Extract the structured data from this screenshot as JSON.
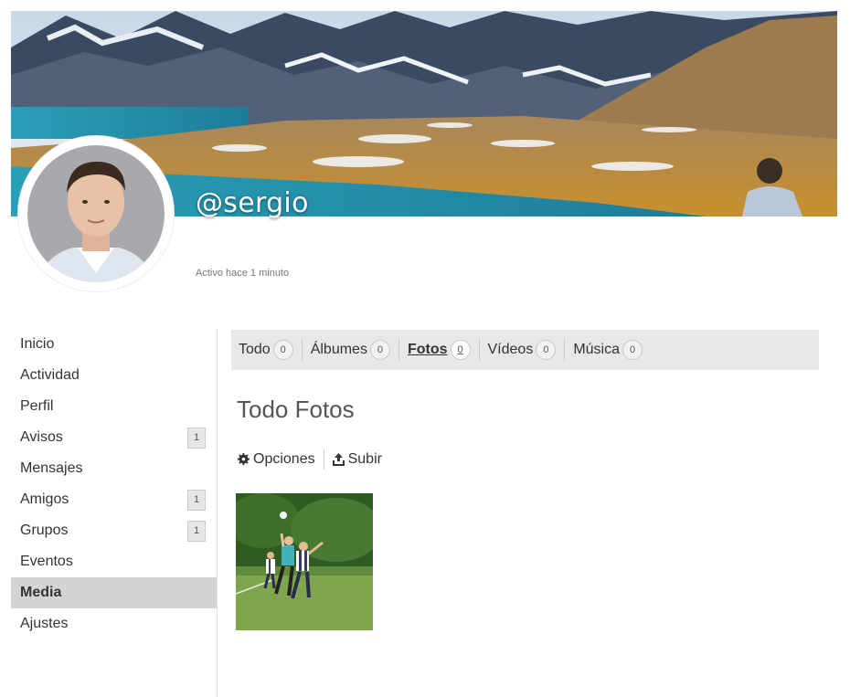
{
  "profile": {
    "username": "@sergio",
    "activity": "Activo hace 1 minuto"
  },
  "sidebar": {
    "items": [
      {
        "label": "Inicio",
        "count": ""
      },
      {
        "label": "Actividad",
        "count": ""
      },
      {
        "label": "Perfil",
        "count": ""
      },
      {
        "label": "Avisos",
        "count": "1"
      },
      {
        "label": "Mensajes",
        "count": ""
      },
      {
        "label": "Amigos",
        "count": "1"
      },
      {
        "label": "Grupos",
        "count": "1"
      },
      {
        "label": "Eventos",
        "count": ""
      },
      {
        "label": "Media",
        "count": "",
        "active": true
      },
      {
        "label": "Ajustes",
        "count": ""
      }
    ]
  },
  "tabs": [
    {
      "label": "Todo",
      "count": "0"
    },
    {
      "label": "Álbumes",
      "count": "0"
    },
    {
      "label": "Fotos",
      "count": "0",
      "active": true
    },
    {
      "label": "Vídeos",
      "count": "0"
    },
    {
      "label": "Música",
      "count": "0"
    }
  ],
  "main": {
    "title": "Todo Fotos",
    "options_label": "Opciones",
    "upload_label": "Subir",
    "options_icon": "gear-icon",
    "upload_icon": "upload-icon"
  },
  "colors": {
    "active_bg": "#d4d4d4",
    "tabs_bg": "#e8e8e8"
  }
}
